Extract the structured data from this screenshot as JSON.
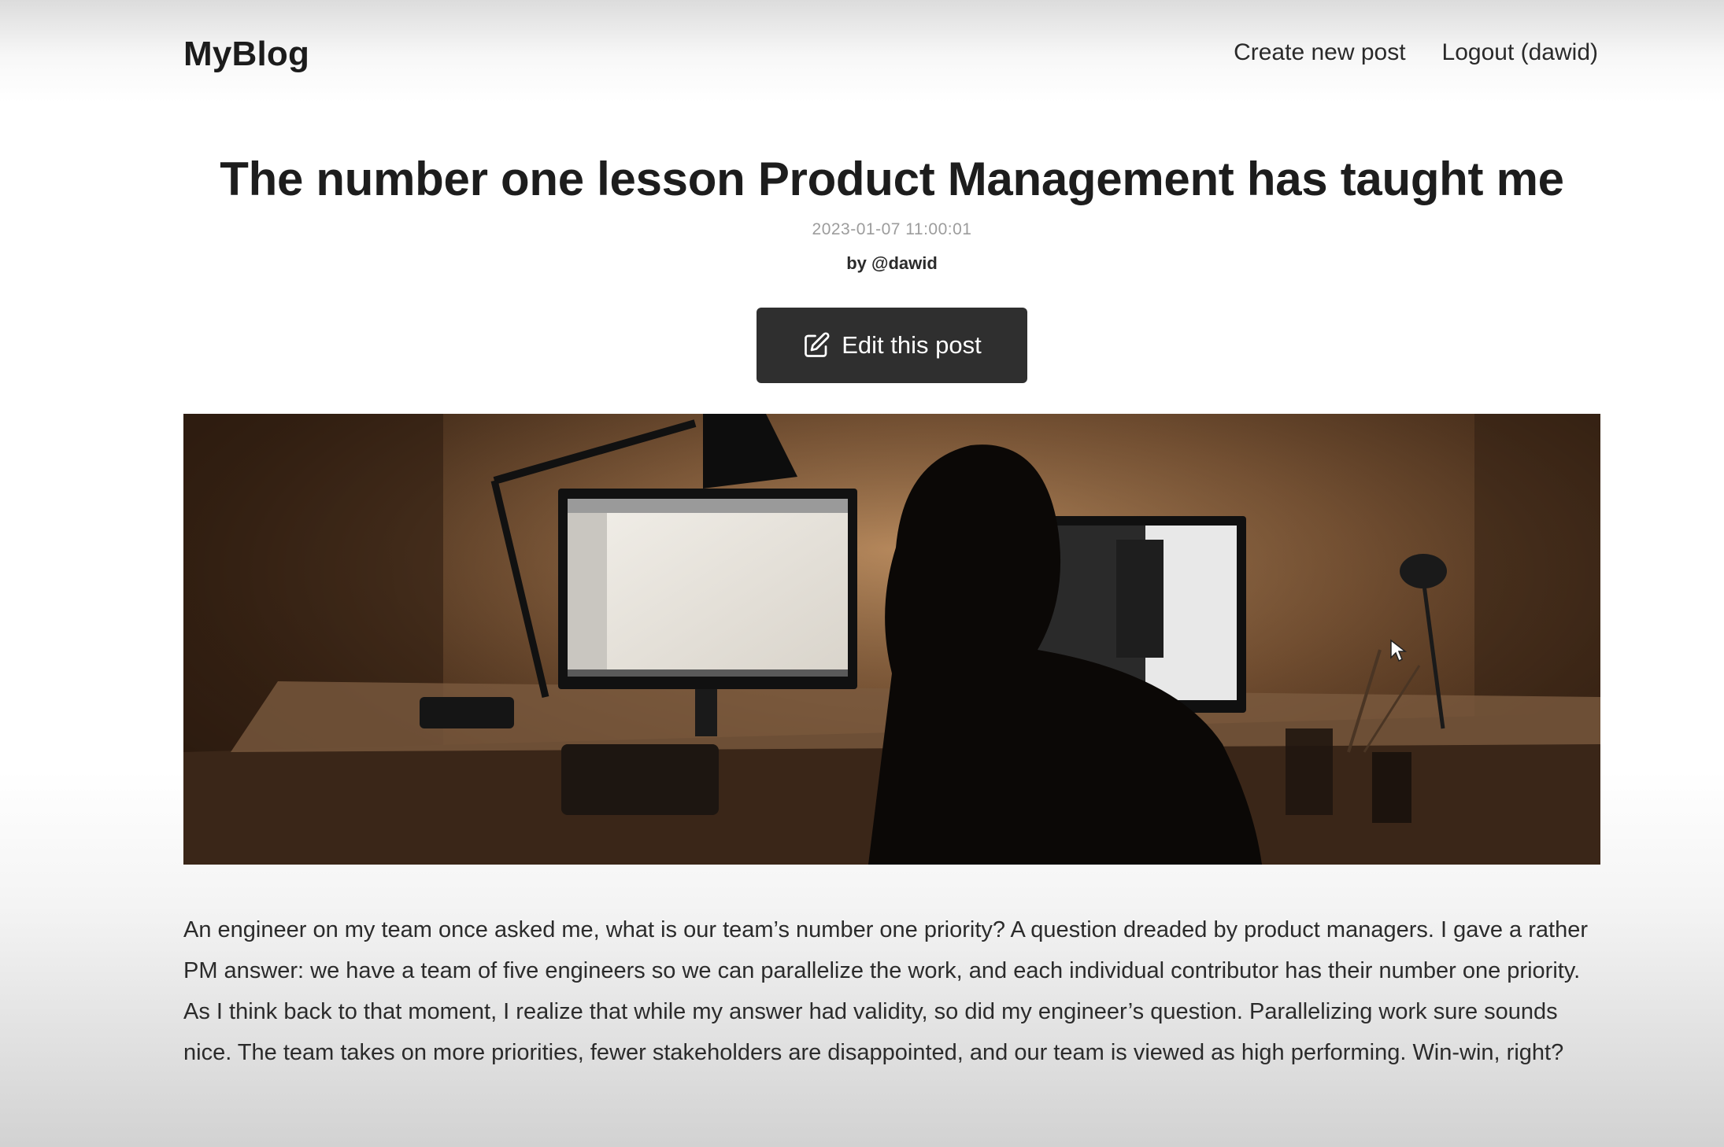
{
  "navbar": {
    "brand": "MyBlog",
    "links": [
      {
        "label": "Create new post"
      },
      {
        "label": "Logout (dawid)"
      }
    ]
  },
  "post": {
    "title": "The number one lesson Product Management has taught me",
    "date": "2023-01-07 11:00:01",
    "author": "by @dawid",
    "edit_label": "Edit this post",
    "edit_icon": "pencil-square-icon",
    "body": "An engineer on my team once asked me, what is our team’s number one priority? A question dreaded by product managers. I gave a rather PM answer: we have a team of five engineers so we can parallelize the work, and each individual contributor has their number one priority. As I think back to that moment, I realize that while my answer had validity, so did my engineer’s question. Parallelizing work sure sounds nice. The team takes on more priorities, fewer stakeholders are disappointed, and our team is viewed as high performing. Win-win, right?"
  },
  "colors": {
    "button_bg": "#2f2f2f",
    "text": "#1f1f1f",
    "muted": "#9c9c9c"
  }
}
